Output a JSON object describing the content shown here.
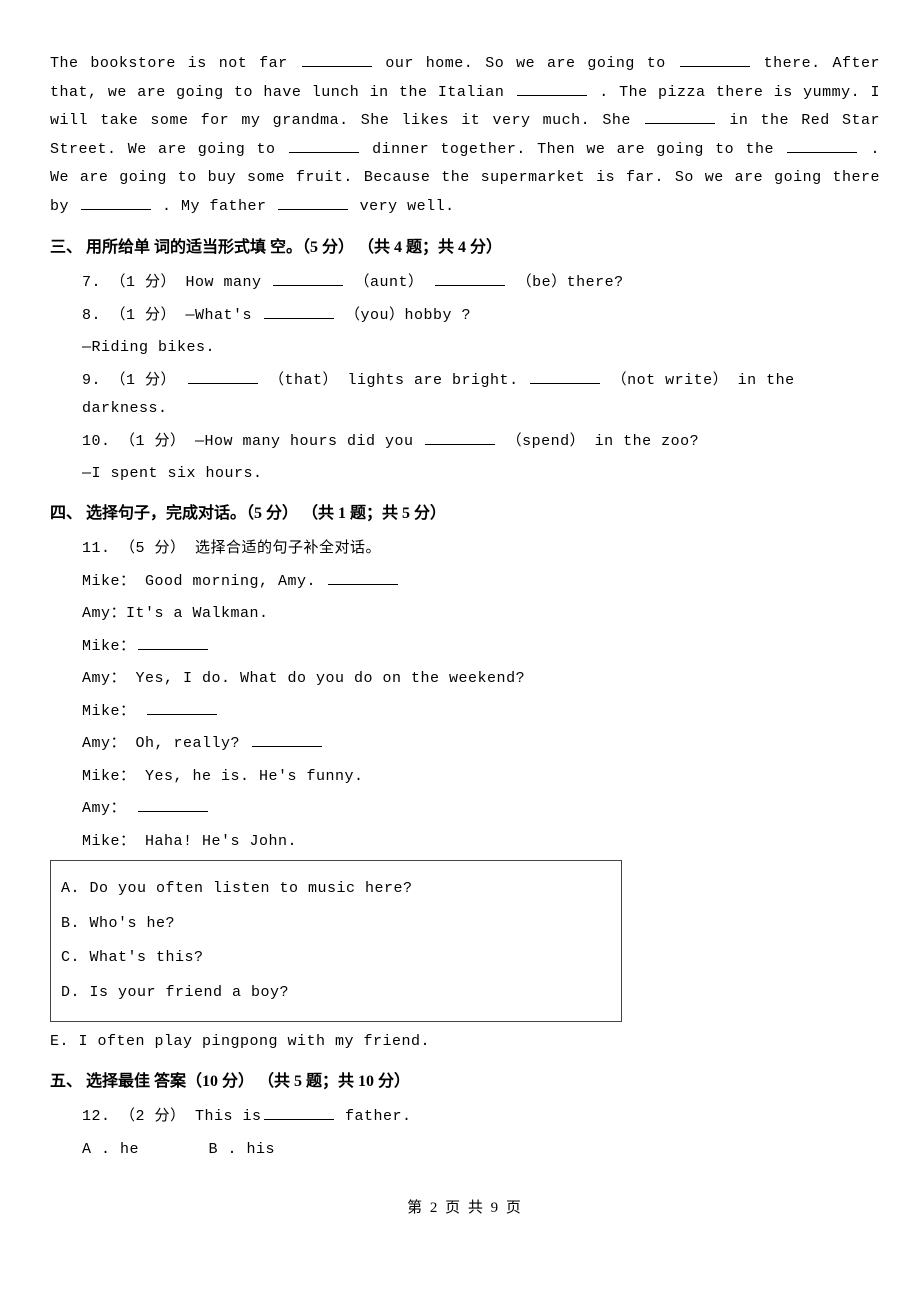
{
  "passage": {
    "t1": "The bookstore is not far ",
    "t2": "our home. So we are going to ",
    "t3": "there. After that, we are going to have lunch in the Italian ",
    "t4": ". The pizza there is yummy. I will take some for my grandma. She likes it very much. She ",
    "t5": "in the Red Star Street. We are going to ",
    "t6": "dinner together. Then we are going to the ",
    "t7": ". We are going to buy some fruit. Because the supermarket is far. So we are going there by ",
    "t8": ". My father ",
    "t9": "very well."
  },
  "section3": {
    "heading": "三、 用所给单 词的适当形式填 空。（5 分） （共 4 题；共 4 分）",
    "q7a": "7. （1 分） How many ",
    "q7b": " （aunt） ",
    "q7c": " （be）there?",
    "q8a": "8. （1 分） —What's ",
    "q8b": " （you）hobby ?",
    "q8ans": "—Riding bikes.",
    "q9a": "9. （1 分） ",
    "q9b": " （that） lights are bright. ",
    "q9c": " （not write） in the darkness.",
    "q10a": "10. （1 分） —How many hours did you ",
    "q10b": " （spend） in the zoo?",
    "q10ans": "—I spent six hours."
  },
  "section4": {
    "heading": "四、 选择句子，完成对话。（5 分） （共 1 题；共 5 分）",
    "intro": "11. （5 分） 选择合适的句子补全对话。",
    "l1": "Mike： Good morning, Amy. ",
    "l2": "Amy：It's a Walkman.",
    "l3": "Mike：",
    "l4": "Amy： Yes, I do. What do you do on the weekend?",
    "l5": "Mike： ",
    "l6": "Amy： Oh, really? ",
    "l7": "Mike： Yes, he is. He's funny.",
    "l8": "Amy： ",
    "l9": "Mike： Haha! He's John.",
    "choices": {
      "a": "A. Do you often listen to music here?",
      "b": "B. Who's he?",
      "c": "C. What's this?",
      "d": "D. Is your friend a boy?",
      "e": "E. I often play pingpong with my friend."
    }
  },
  "section5": {
    "heading": "五、 选择最佳 答案（10 分） （共 5 题；共 10 分）",
    "q12a": "12. （2 分） This is",
    "q12b": " father.",
    "optA": "A . he",
    "optB": "B . his"
  },
  "footer": "第 2 页 共 9 页"
}
